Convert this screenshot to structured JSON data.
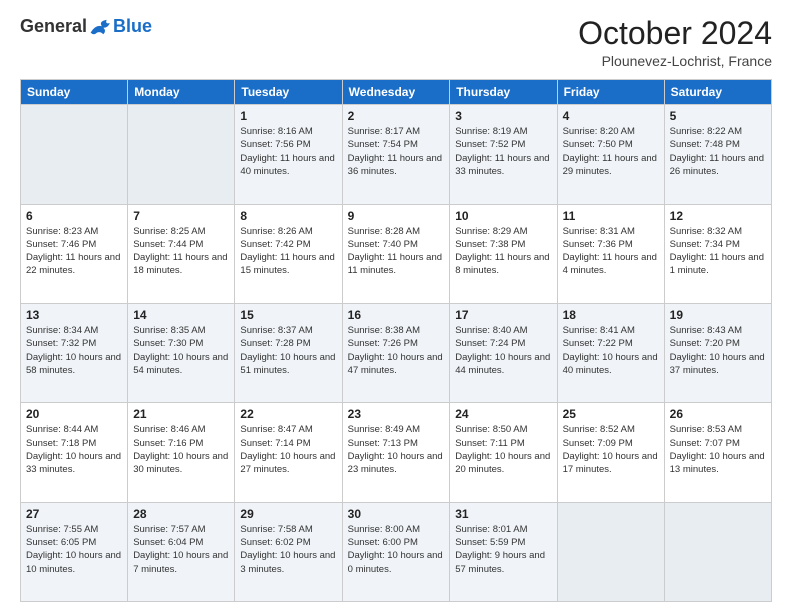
{
  "header": {
    "logo_general": "General",
    "logo_blue": "Blue",
    "month_title": "October 2024",
    "location": "Plounevez-Lochrist, France"
  },
  "weekdays": [
    "Sunday",
    "Monday",
    "Tuesday",
    "Wednesday",
    "Thursday",
    "Friday",
    "Saturday"
  ],
  "weeks": [
    [
      {
        "day": "",
        "info": ""
      },
      {
        "day": "",
        "info": ""
      },
      {
        "day": "1",
        "info": "Sunrise: 8:16 AM\nSunset: 7:56 PM\nDaylight: 11 hours and 40 minutes."
      },
      {
        "day": "2",
        "info": "Sunrise: 8:17 AM\nSunset: 7:54 PM\nDaylight: 11 hours and 36 minutes."
      },
      {
        "day": "3",
        "info": "Sunrise: 8:19 AM\nSunset: 7:52 PM\nDaylight: 11 hours and 33 minutes."
      },
      {
        "day": "4",
        "info": "Sunrise: 8:20 AM\nSunset: 7:50 PM\nDaylight: 11 hours and 29 minutes."
      },
      {
        "day": "5",
        "info": "Sunrise: 8:22 AM\nSunset: 7:48 PM\nDaylight: 11 hours and 26 minutes."
      }
    ],
    [
      {
        "day": "6",
        "info": "Sunrise: 8:23 AM\nSunset: 7:46 PM\nDaylight: 11 hours and 22 minutes."
      },
      {
        "day": "7",
        "info": "Sunrise: 8:25 AM\nSunset: 7:44 PM\nDaylight: 11 hours and 18 minutes."
      },
      {
        "day": "8",
        "info": "Sunrise: 8:26 AM\nSunset: 7:42 PM\nDaylight: 11 hours and 15 minutes."
      },
      {
        "day": "9",
        "info": "Sunrise: 8:28 AM\nSunset: 7:40 PM\nDaylight: 11 hours and 11 minutes."
      },
      {
        "day": "10",
        "info": "Sunrise: 8:29 AM\nSunset: 7:38 PM\nDaylight: 11 hours and 8 minutes."
      },
      {
        "day": "11",
        "info": "Sunrise: 8:31 AM\nSunset: 7:36 PM\nDaylight: 11 hours and 4 minutes."
      },
      {
        "day": "12",
        "info": "Sunrise: 8:32 AM\nSunset: 7:34 PM\nDaylight: 11 hours and 1 minute."
      }
    ],
    [
      {
        "day": "13",
        "info": "Sunrise: 8:34 AM\nSunset: 7:32 PM\nDaylight: 10 hours and 58 minutes."
      },
      {
        "day": "14",
        "info": "Sunrise: 8:35 AM\nSunset: 7:30 PM\nDaylight: 10 hours and 54 minutes."
      },
      {
        "day": "15",
        "info": "Sunrise: 8:37 AM\nSunset: 7:28 PM\nDaylight: 10 hours and 51 minutes."
      },
      {
        "day": "16",
        "info": "Sunrise: 8:38 AM\nSunset: 7:26 PM\nDaylight: 10 hours and 47 minutes."
      },
      {
        "day": "17",
        "info": "Sunrise: 8:40 AM\nSunset: 7:24 PM\nDaylight: 10 hours and 44 minutes."
      },
      {
        "day": "18",
        "info": "Sunrise: 8:41 AM\nSunset: 7:22 PM\nDaylight: 10 hours and 40 minutes."
      },
      {
        "day": "19",
        "info": "Sunrise: 8:43 AM\nSunset: 7:20 PM\nDaylight: 10 hours and 37 minutes."
      }
    ],
    [
      {
        "day": "20",
        "info": "Sunrise: 8:44 AM\nSunset: 7:18 PM\nDaylight: 10 hours and 33 minutes."
      },
      {
        "day": "21",
        "info": "Sunrise: 8:46 AM\nSunset: 7:16 PM\nDaylight: 10 hours and 30 minutes."
      },
      {
        "day": "22",
        "info": "Sunrise: 8:47 AM\nSunset: 7:14 PM\nDaylight: 10 hours and 27 minutes."
      },
      {
        "day": "23",
        "info": "Sunrise: 8:49 AM\nSunset: 7:13 PM\nDaylight: 10 hours and 23 minutes."
      },
      {
        "day": "24",
        "info": "Sunrise: 8:50 AM\nSunset: 7:11 PM\nDaylight: 10 hours and 20 minutes."
      },
      {
        "day": "25",
        "info": "Sunrise: 8:52 AM\nSunset: 7:09 PM\nDaylight: 10 hours and 17 minutes."
      },
      {
        "day": "26",
        "info": "Sunrise: 8:53 AM\nSunset: 7:07 PM\nDaylight: 10 hours and 13 minutes."
      }
    ],
    [
      {
        "day": "27",
        "info": "Sunrise: 7:55 AM\nSunset: 6:05 PM\nDaylight: 10 hours and 10 minutes."
      },
      {
        "day": "28",
        "info": "Sunrise: 7:57 AM\nSunset: 6:04 PM\nDaylight: 10 hours and 7 minutes."
      },
      {
        "day": "29",
        "info": "Sunrise: 7:58 AM\nSunset: 6:02 PM\nDaylight: 10 hours and 3 minutes."
      },
      {
        "day": "30",
        "info": "Sunrise: 8:00 AM\nSunset: 6:00 PM\nDaylight: 10 hours and 0 minutes."
      },
      {
        "day": "31",
        "info": "Sunrise: 8:01 AM\nSunset: 5:59 PM\nDaylight: 9 hours and 57 minutes."
      },
      {
        "day": "",
        "info": ""
      },
      {
        "day": "",
        "info": ""
      }
    ]
  ]
}
